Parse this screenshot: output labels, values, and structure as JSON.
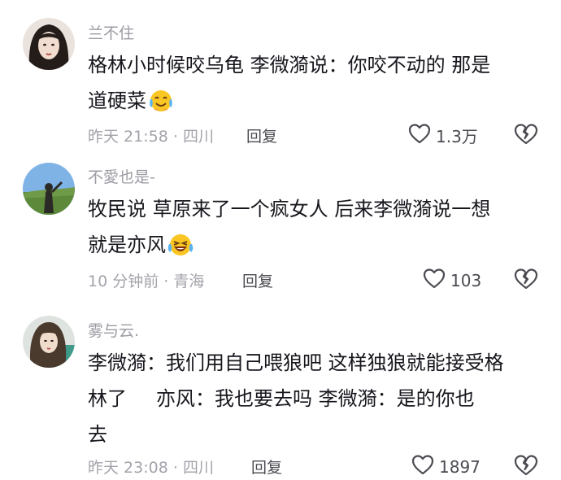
{
  "comments": [
    {
      "username": "兰不住",
      "lines": [
        "格林小时候咬乌龟 李微漪说：你咬不动的 那是",
        "道硬菜"
      ],
      "emoji": "smiling-tear-emoji",
      "time": "昨天 21:58",
      "location": "四川",
      "reply": "回复",
      "likes": "1.3万"
    },
    {
      "username": "不愛也是-",
      "lines": [
        "牧民说 草原来了一个疯女人 后来李微漪说一想",
        "就是亦风"
      ],
      "emoji": "laughing-tears-emoji",
      "time": "10 分钟前",
      "location": "青海",
      "reply": "回复",
      "likes": "103"
    },
    {
      "username": "雾与云.",
      "lines": [
        "李微漪：我们用自己喂狼吧 这样独狼就能接受格",
        "林了",
        "亦风：我也要去吗 李微漪：是的你也",
        "去"
      ],
      "time": "昨天 23:08",
      "location": "四川",
      "reply": "回复",
      "likes": "1897"
    }
  ],
  "separator": "·",
  "colors": {
    "text": "#16161d",
    "meta": "#a3a3ab",
    "username": "#9b9ba3",
    "action": "#4b4b52"
  }
}
